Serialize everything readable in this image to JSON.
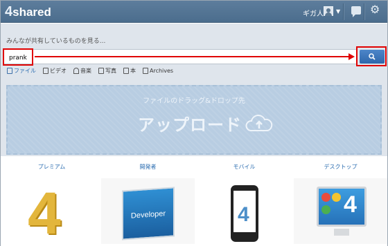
{
  "topbar": {
    "logo_num": "4",
    "logo_text": "shared",
    "user_name": "ギガ人",
    "icons": [
      "user-icon",
      "chevron-down-icon",
      "chat-icon",
      "gear-icon"
    ]
  },
  "search": {
    "hint": "みんなが共有しているものを見る...",
    "value": "prank",
    "button_icon": "search-icon"
  },
  "filters": [
    {
      "label": "ファイル",
      "icon": "file-icon",
      "active": true
    },
    {
      "label": "ビデオ",
      "icon": "video-icon"
    },
    {
      "label": "音楽",
      "icon": "headphones-icon"
    },
    {
      "label": "写真",
      "icon": "photo-icon"
    },
    {
      "label": "本",
      "icon": "book-icon"
    },
    {
      "label": "Archives",
      "icon": "archive-icon"
    }
  ],
  "upload": {
    "hint": "ファイルのドラッグ&ドロップ先",
    "title": "アップロード",
    "icon": "cloud-upload-icon"
  },
  "categories": [
    "プレミアム",
    "開発者",
    "モバイル",
    "デスクトップ"
  ],
  "tiles": {
    "developer_label": "Developer",
    "phone_label": "4",
    "desktop_label": "4",
    "premium_label": "4"
  },
  "colors": {
    "topbar": "#4f708f",
    "accent": "#2a6cb0",
    "annotation": "#e00000",
    "dropzone": "#b8cde2"
  }
}
